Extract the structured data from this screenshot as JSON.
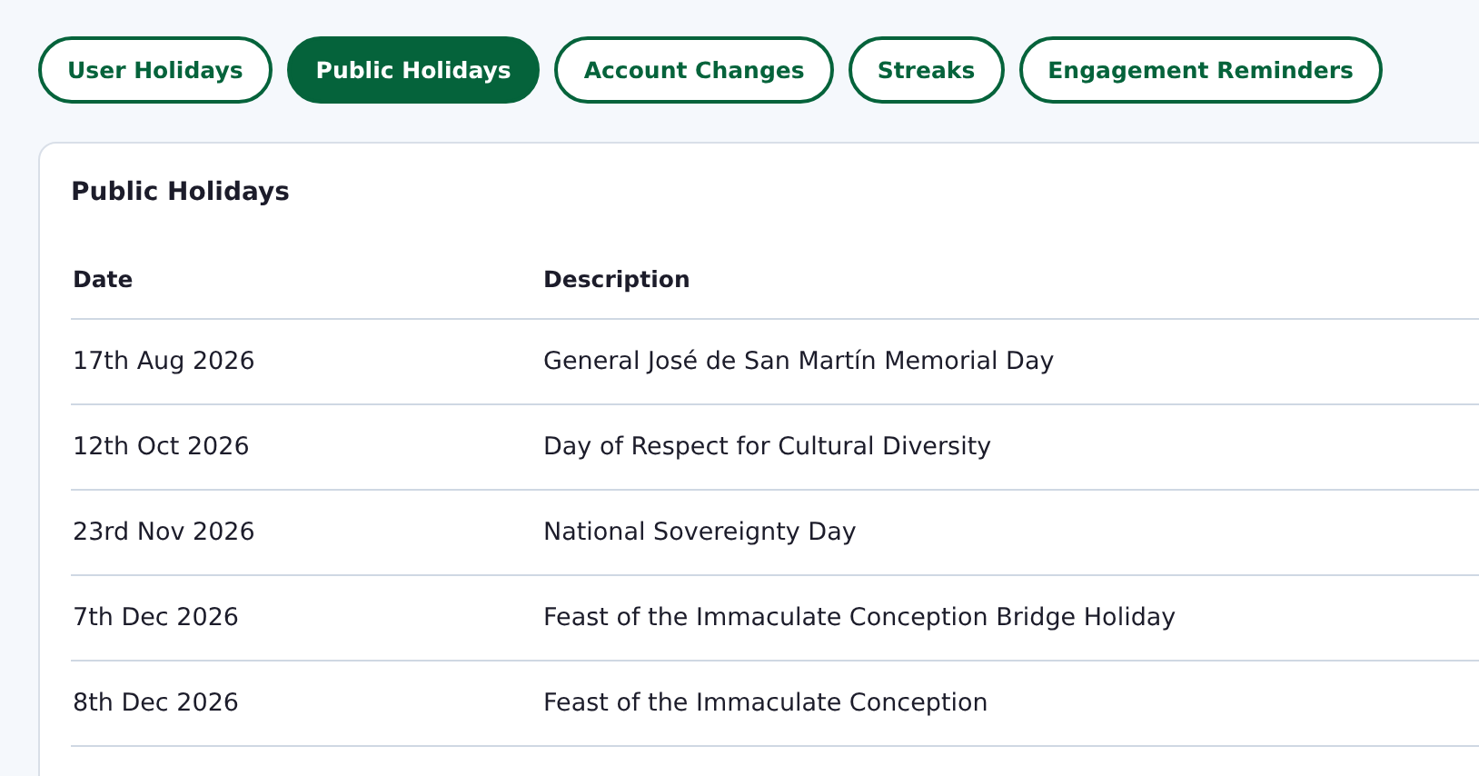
{
  "tabs": [
    {
      "label": "User Holidays",
      "selected": false
    },
    {
      "label": "Public Holidays",
      "selected": true
    },
    {
      "label": "Account Changes",
      "selected": false
    },
    {
      "label": "Streaks",
      "selected": false
    },
    {
      "label": "Engagement Reminders",
      "selected": false
    }
  ],
  "card": {
    "title": "Public Holidays",
    "table": {
      "columns": [
        "Date",
        "Description"
      ],
      "rows": [
        [
          "17th Aug 2026",
          "General José de San Martín Memorial Day"
        ],
        [
          "12th Oct 2026",
          "Day of Respect for Cultural Diversity"
        ],
        [
          "23rd Nov 2026",
          "National Sovereignty Day"
        ],
        [
          "7th Dec 2026",
          "Feast of the Immaculate Conception Bridge Holiday"
        ],
        [
          "8th Dec 2026",
          "Feast of the Immaculate Conception"
        ]
      ]
    }
  }
}
